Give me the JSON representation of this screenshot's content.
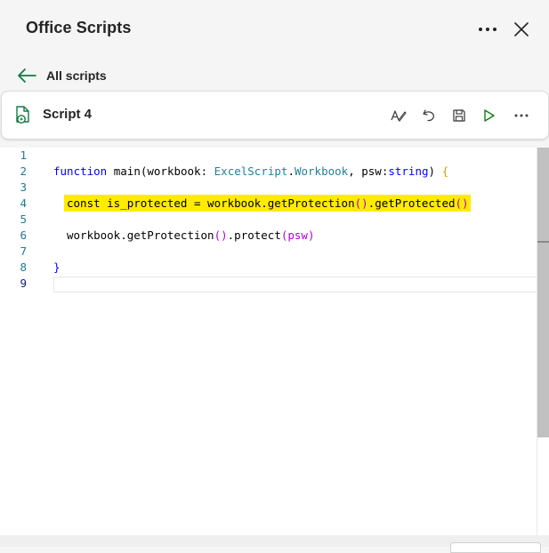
{
  "pane": {
    "title": "Office Scripts",
    "more_icon": "more-horizontal-icon",
    "close_icon": "close-icon"
  },
  "nav": {
    "back_label": "All scripts",
    "back_icon": "arrow-left-icon"
  },
  "script": {
    "name": "Script 4",
    "icon": "script-file-icon",
    "toolbar": [
      {
        "name": "spell-check-icon"
      },
      {
        "name": "undo-icon"
      },
      {
        "name": "save-icon"
      },
      {
        "name": "run-icon"
      },
      {
        "name": "more-horizontal-icon"
      }
    ]
  },
  "editor": {
    "line_numbers": [
      "1",
      "2",
      "3",
      "4",
      "5",
      "6",
      "7",
      "8",
      "9"
    ],
    "lines": {
      "l2": {
        "kw": "function",
        "rest1": " main(workbook: ",
        "type1": "ExcelScript",
        "dot": ".",
        "type2": "Workbook",
        "rest2": ", psw:",
        "kw2": "string",
        "rest3": ") ",
        "brace": "{"
      },
      "l4": {
        "a": "const is_protected = workbook.getProtection",
        "p1": "()",
        "b": ".getProtected",
        "p2": "()"
      },
      "l6": {
        "a": "workbook.getProtection",
        "p1": "()",
        "b": ".protect",
        "p2": "(psw)"
      },
      "l8": {
        "brace": "}"
      }
    }
  },
  "colors": {
    "highlight": "#ffeb00",
    "keyword": "#0000ff",
    "type": "#267f99",
    "run_green": "#107c10",
    "accent_green": "#107c41"
  }
}
